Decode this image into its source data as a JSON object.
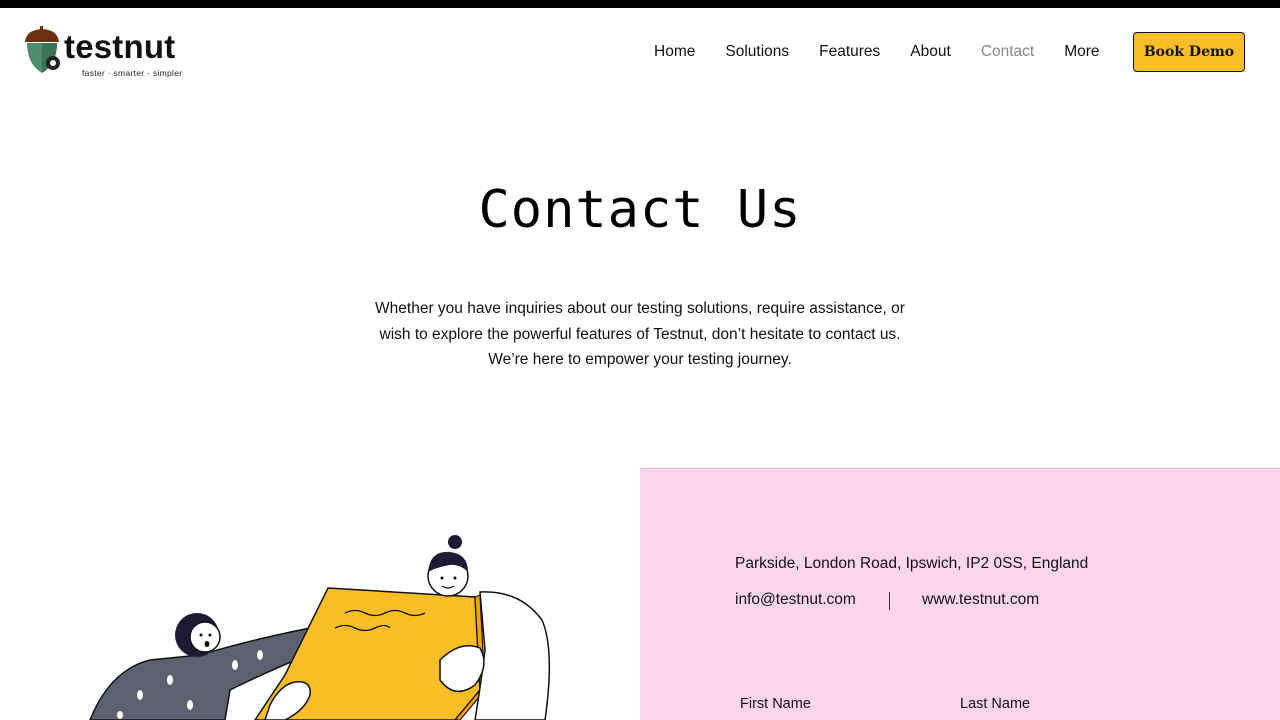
{
  "brand": {
    "name": "testnut",
    "tagline": "faster · smarter · simpler",
    "colors": {
      "accent": "#fbbe26",
      "panel": "#fdd5ef",
      "acorn_cap": "#6b2f12",
      "acorn_body": "#4e8c6e"
    }
  },
  "nav": {
    "items": [
      {
        "label": "Home"
      },
      {
        "label": "Solutions"
      },
      {
        "label": "Features"
      },
      {
        "label": "About"
      },
      {
        "label": "Contact",
        "active": true
      },
      {
        "label": "More"
      }
    ],
    "cta_label": "Book Demo"
  },
  "hero": {
    "title": "Contact Us",
    "text": "Whether you have inquiries about our testing solutions, require assistance, or wish to explore the powerful features of Testnut, don’t hesitate to contact us. We’re here to empower your testing journey."
  },
  "contact": {
    "address": "Parkside, London Road, Ipswich, IP2 0SS, England",
    "email": "info@testnut.com",
    "website": "www.testnut.com",
    "form": {
      "first_name_label": "First Name",
      "last_name_label": "Last Name"
    }
  }
}
